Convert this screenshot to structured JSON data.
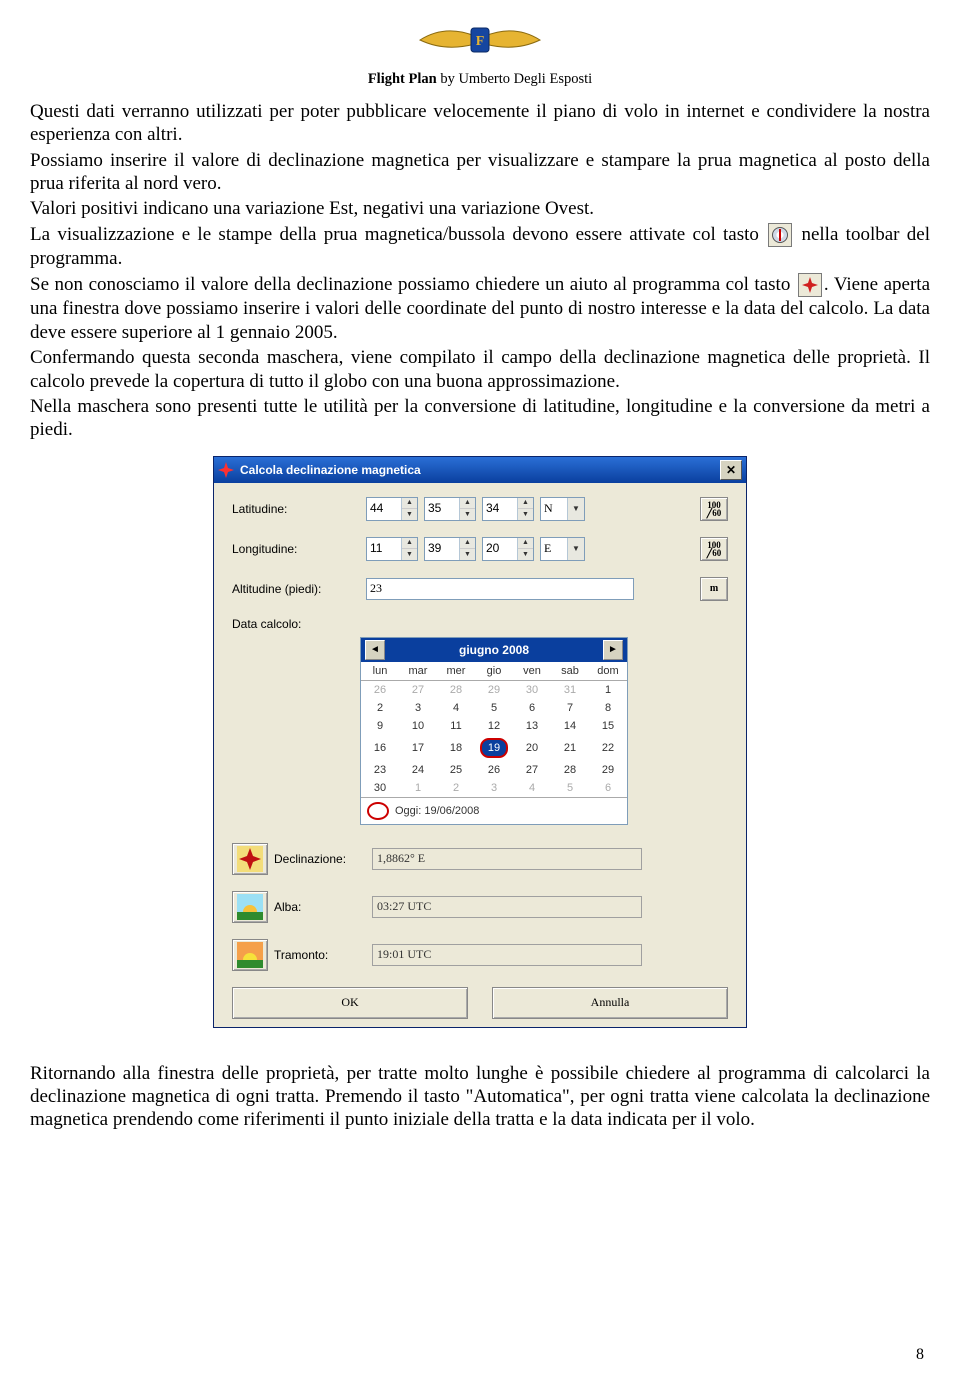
{
  "header": {
    "title_left": "Flight Plan",
    "title_right": " by Umberto Degli Esposti"
  },
  "text": {
    "p1": "Questi dati verranno utilizzati per poter pubblicare velocemente il piano di volo in internet e condividere la nostra esperienza con altri.",
    "p2": "Possiamo inserire il valore di declinazione magnetica per visualizzare e stampare la prua magnetica al posto della prua riferita al nord vero.",
    "p3": "Valori positivi indicano una variazione Est, negativi una variazione Ovest.",
    "p4a": "La visualizzazione e le stampe della prua magnetica/bussola devono essere attivate col tasto ",
    "p4b": " nella toolbar del programma.",
    "p5a": "Se non conosciamo il valore della declinazione possiamo chiedere un aiuto al programma col tasto ",
    "p5b": ". Viene aperta una finestra dove possiamo inserire i valori delle coordinate del punto di nostro interesse e la data del calcolo. La data deve essere superiore al 1 gennaio 2005.",
    "p6": "Confermando questa seconda maschera, viene compilato il campo della declinazione magnetica delle proprietà. Il calcolo prevede la copertura di tutto il globo con una buona approssimazione.",
    "p7": "Nella maschera sono presenti tutte le utilità per la conversione di latitudine, longitudine e la conversione da metri a piedi.",
    "bottom": "Ritornando alla finestra delle proprietà, per tratte molto lunghe è possibile chiedere al programma di calcolarci la declinazione magnetica di ogni tratta. Premendo il tasto \"Automatica\", per ogni tratta viene calcolata la declinazione magnetica prendendo come riferimenti il punto iniziale della tratta e la data indicata per il volo."
  },
  "dialog": {
    "title": "Calcola declinazione magnetica",
    "labels": {
      "lat": "Latitudine:",
      "lon": "Longitudine:",
      "alt": "Altitudine (piedi):",
      "date": "Data calcolo:",
      "decl": "Declinazione:",
      "alba": "Alba:",
      "tram": "Tramonto:"
    },
    "lat": {
      "deg": "44",
      "min": "35",
      "sec": "34",
      "hemi": "N"
    },
    "lon": {
      "deg": "11",
      "min": "39",
      "sec": "20",
      "hemi": "E"
    },
    "alt_value": "23",
    "btn_frac_top": "100",
    "btn_frac_bot": "60",
    "btn_m": "m",
    "cal": {
      "month": "giugno 2008",
      "dow": [
        "lun",
        "mar",
        "mer",
        "gio",
        "ven",
        "sab",
        "dom"
      ],
      "cells": [
        [
          "26",
          "27",
          "28",
          "29",
          "30",
          "31",
          "1"
        ],
        [
          "2",
          "3",
          "4",
          "5",
          "6",
          "7",
          "8"
        ],
        [
          "9",
          "10",
          "11",
          "12",
          "13",
          "14",
          "15"
        ],
        [
          "16",
          "17",
          "18",
          "19",
          "20",
          "21",
          "22"
        ],
        [
          "23",
          "24",
          "25",
          "26",
          "27",
          "28",
          "29"
        ],
        [
          "30",
          "1",
          "2",
          "3",
          "4",
          "5",
          "6"
        ]
      ],
      "dim_first_count": 6,
      "dim_last_count": 6,
      "selected": "19",
      "today_label": "Oggi: 19/06/2008"
    },
    "decl_value": "1,8862° E",
    "alba_value": "03:27 UTC",
    "tram_value": "19:01 UTC",
    "ok": "OK",
    "cancel": "Annulla"
  },
  "page_number": "8"
}
